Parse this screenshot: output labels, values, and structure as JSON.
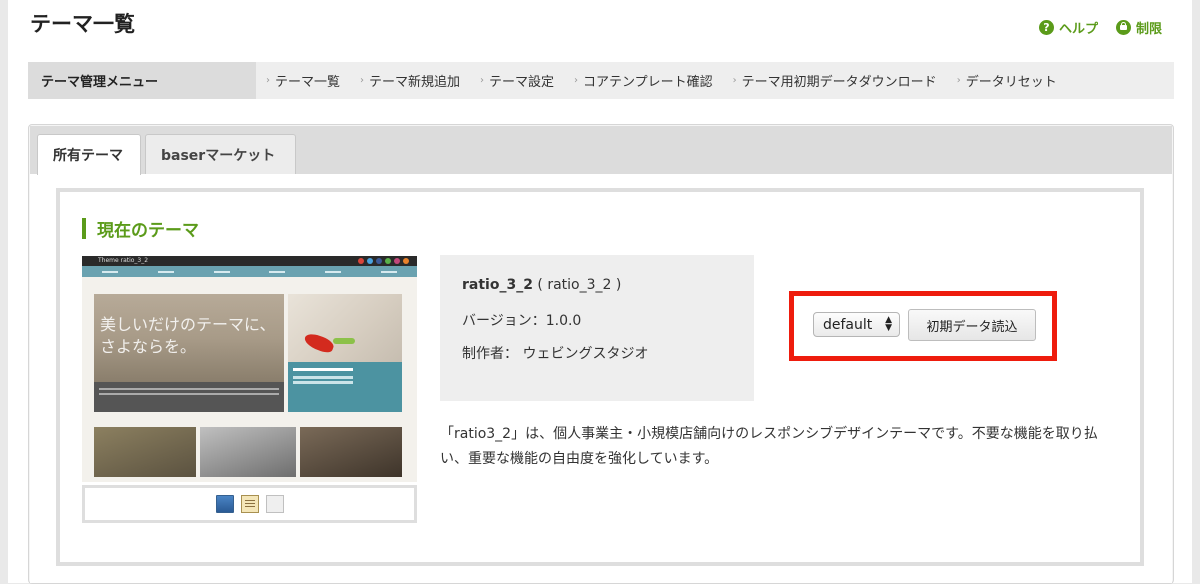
{
  "header": {
    "title": "テーマ一覧",
    "help_label": "ヘルプ",
    "restrict_label": "制限",
    "help_icon_glyph": "?"
  },
  "menu": {
    "title": "テーマ管理メニュー",
    "chevron": "›",
    "items": [
      {
        "label": "テーマ一覧"
      },
      {
        "label": "テーマ新規追加"
      },
      {
        "label": "テーマ設定"
      },
      {
        "label": "コアテンプレート確認"
      },
      {
        "label": "テーマ用初期データダウンロード"
      },
      {
        "label": "データリセット"
      }
    ]
  },
  "tabs": [
    {
      "label": "所有テーマ",
      "active": true
    },
    {
      "label": "baserマーケット",
      "active": false
    }
  ],
  "current_theme": {
    "heading": "現在のテーマ",
    "screenshot": {
      "site_title": "Theme ratio_3_2",
      "hero_text_line1": "美しいだけのテーマに、",
      "hero_text_line2": "さよならを。"
    },
    "name": "ratio_3_2",
    "name_paren": "( ratio_3_2 )",
    "version": "バージョン：1.0.0",
    "author": "制作者：  ウェビングスタジオ",
    "select_value": "default",
    "load_button": "初期データ読込",
    "description": "「ratio3_2」は、個人事業主・小規模店舗向けのレスポンシブデザインテーマです。不要な機能を取り払い、重要な機能の自由度を強化しています。"
  },
  "colors": {
    "accent_green": "#5b9b1a",
    "highlight_red": "#ee1c0d"
  },
  "icons": [
    "help-icon",
    "lock-icon",
    "screenshot-icon",
    "edit-icon",
    "copy-icon"
  ]
}
